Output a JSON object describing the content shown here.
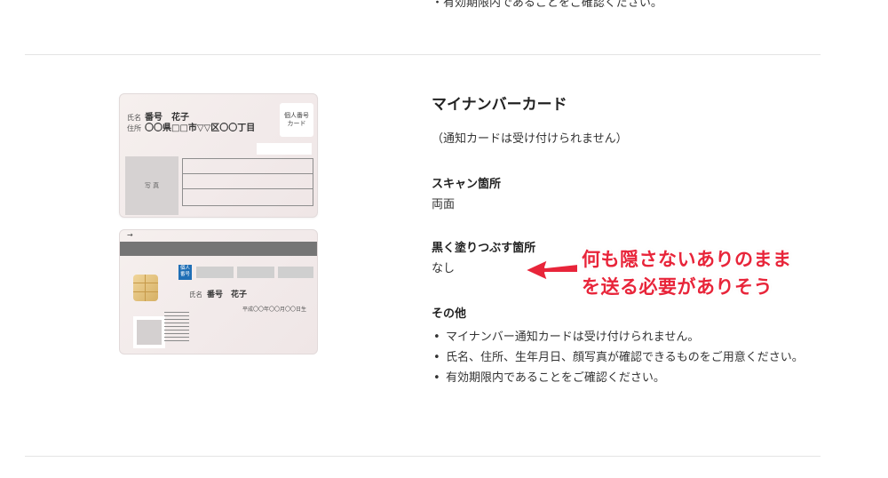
{
  "top_note": "・有効期限内であることをご確認ください。",
  "card_front": {
    "name_label": "氏名",
    "name_value": "番号　花子",
    "address_label": "住所",
    "address_value": "〇〇県□□市▽▽区〇〇丁目",
    "badge_line1": "個人番号",
    "badge_line2": "カード",
    "photo_label": "写 真"
  },
  "card_back": {
    "arrow": "→",
    "badge_line1": "個人",
    "badge_line2": "番号",
    "name_label": "氏名",
    "name_value": "番号　花子",
    "dob_text": "平成〇〇年〇〇月〇〇日生"
  },
  "doc": {
    "title": "マイナンバーカード",
    "subtitle": "（通知カードは受け付けられません）",
    "scan_heading": "スキャン箇所",
    "scan_value": "両面",
    "blackout_heading": "黒く塗りつぶす箇所",
    "blackout_value": "なし",
    "other_heading": "その他",
    "notes": [
      "マイナンバー通知カードは受け付けられません。",
      "氏名、住所、生年月日、顔写真が確認できるものをご用意ください。",
      "有効期限内であることをご確認ください。"
    ]
  },
  "annotation": {
    "line1": "何も隠さないありのまま",
    "line2": "を送る必要がありそう",
    "color": "#e8253a"
  }
}
